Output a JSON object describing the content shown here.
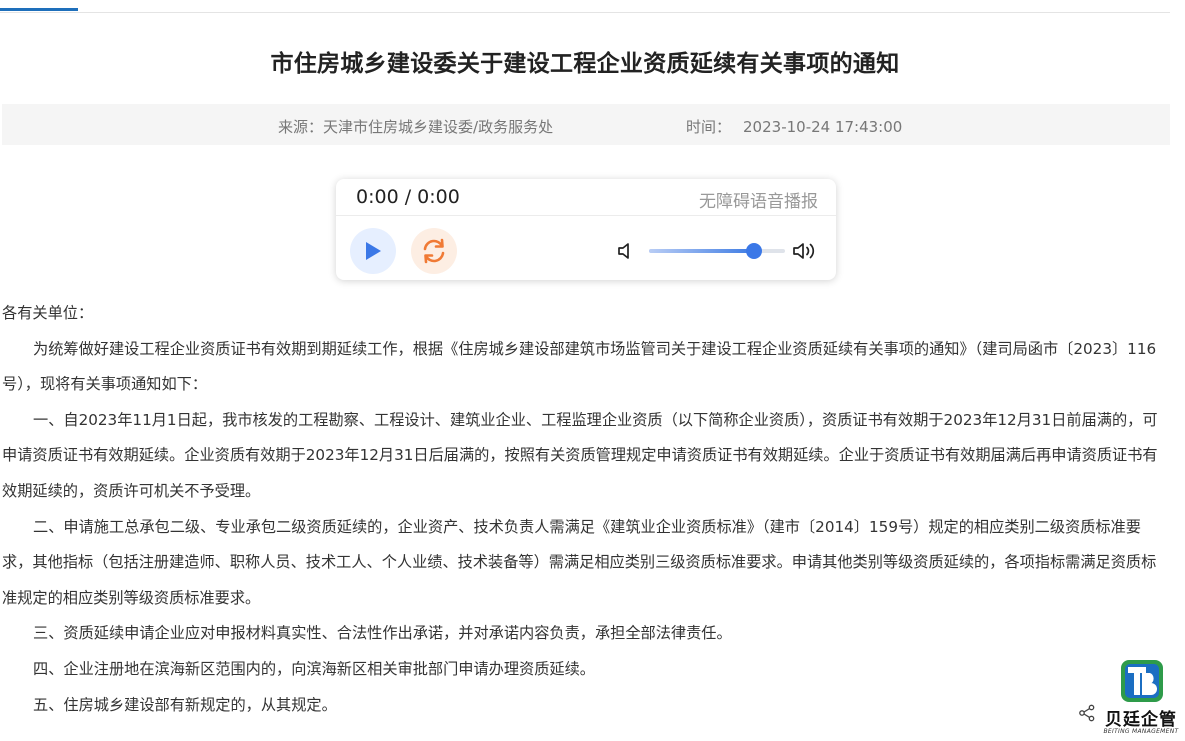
{
  "article": {
    "title": "市住房城乡建设委关于建设工程企业资质延续有关事项的通知",
    "source_label": "来源：",
    "source_value": "天津市住房城乡建设委/政务服务处",
    "time_label": "时间：",
    "time_value": "2023-10-24 17:43:00"
  },
  "player": {
    "time_display": "0:00 / 0:00",
    "accessibility_label": "无障碍语音播报",
    "volume_level": 0.77,
    "accent_color": "#3b78e7"
  },
  "body": {
    "salutation": "各有关单位：",
    "paragraphs": [
      "为统筹做好建设工程企业资质证书有效期到期延续工作，根据《住房城乡建设部建筑市场监管司关于建设工程企业资质延续有关事项的通知》（建司局函市〔2023〕116号），现将有关事项通知如下：",
      "一、自2023年11月1日起，我市核发的工程勘察、工程设计、建筑业企业、工程监理企业资质（以下简称企业资质），资质证书有效期于2023年12月31日前届满的，可申请资质证书有效期延续。企业资质有效期于2023年12月31日后届满的，按照有关资质管理规定申请资质证书有效期延续。企业于资质证书有效期届满后再申请资质证书有效期延续的，资质许可机关不予受理。",
      "二、申请施工总承包二级、专业承包二级资质延续的，企业资产、技术负责人需满足《建筑业企业资质标准》（建市〔2014〕159号）规定的相应类别二级资质标准要求，其他指标（包括注册建造师、职称人员、技术工人、个人业绩、技术装备等）需满足相应类别三级资质标准要求。申请其他类别等级资质延续的，各项指标需满足资质标准规定的相应类别等级资质标准要求。",
      "三、资质延续申请企业应对申报材料真实性、合法性作出承诺，并对承诺内容负责，承担全部法律责任。",
      "四、企业注册地在滨海新区范围内的，向滨海新区相关审批部门申请办理资质延续。",
      "五、住房城乡建设部有新规定的，从其规定。"
    ]
  },
  "logo": {
    "name": "贝廷企管",
    "subtitle": "BEITING MANAGEMENT"
  },
  "icons": {
    "play": "play-icon",
    "replay": "replay-icon",
    "volume_low": "volume-low-icon",
    "volume_high": "volume-high-icon",
    "share": "share-icon"
  }
}
